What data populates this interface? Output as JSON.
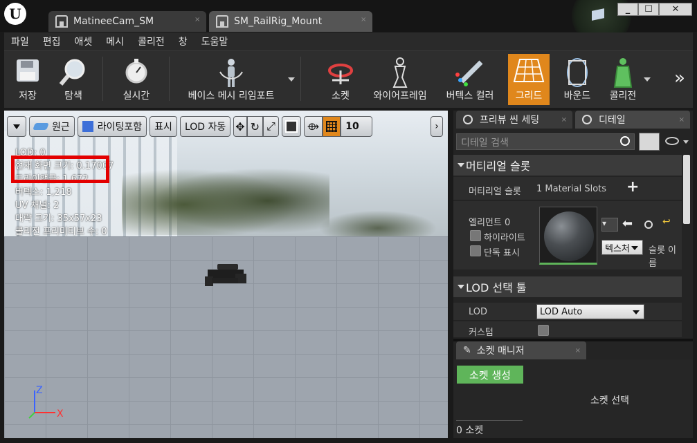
{
  "titlebar": {
    "tabs": [
      {
        "label": "MatineeCam_SM",
        "active": false
      },
      {
        "label": "SM_RailRig_Mount",
        "active": true
      }
    ],
    "window_buttons": [
      "_",
      "☐",
      "✕"
    ]
  },
  "menu": {
    "items": [
      "파일",
      "편집",
      "애셋",
      "메시",
      "콜리전",
      "창",
      "도움말"
    ]
  },
  "toolbar": {
    "buttons": [
      {
        "label": "저장",
        "icon": "save-icon"
      },
      {
        "label": "탐색",
        "icon": "browse-icon"
      },
      {
        "label": "실시간",
        "icon": "stopwatch-icon"
      },
      {
        "label": "베이스 메시 리임포트",
        "icon": "mannequin-icon"
      },
      {
        "label": "소켓",
        "icon": "socket-icon"
      },
      {
        "label": "와이어프레임",
        "icon": "wireframe-icon"
      },
      {
        "label": "버텍스 컬러",
        "icon": "vertex-color-icon"
      },
      {
        "label": "그리드",
        "icon": "grid-icon",
        "active": true
      },
      {
        "label": "바운드",
        "icon": "bounds-icon"
      },
      {
        "label": "콜리전",
        "icon": "collision-icon"
      }
    ],
    "overflow": "»",
    "accent": "#e0871c"
  },
  "viewport": {
    "toolbar": {
      "perspective": "원근",
      "lighting": "라이팅포함",
      "show": "표시",
      "lod": "LOD 자동",
      "grid_size": "10"
    },
    "stats": [
      "LOD:  0",
      "현재 화면 크기: 0.17007",
      "트라이앵글: 1,672",
      "버텍스: 1,218",
      "UV 채널:  2",
      "대략 크기: 35x57x23",
      "콜리전 프리미티브 수: 0"
    ],
    "axes": {
      "z": "Z",
      "x": "X"
    },
    "highlight_color": "#e30000"
  },
  "details": {
    "tabs": [
      "프리뷰 씬 세팅",
      "디테일"
    ],
    "search_placeholder": "디테일 검색",
    "material_section": {
      "title": "머티리얼 슬롯",
      "slots_label": "머티리얼 슬롯",
      "slots_value": "1 Material Slots",
      "element_label": "엘리먼트 0",
      "highlight_label": "하이라이트",
      "isolate_label": "단독 표시",
      "texture_button": "텍스처",
      "slot_name_label": "슬롯 이름"
    },
    "lod_section": {
      "title": "LOD 선택 툴",
      "lod_label": "LOD",
      "lod_value": "LOD Auto",
      "custom_label": "커스텀"
    }
  },
  "socket_manager": {
    "tab": "소켓 매니저",
    "create_button": "소켓 생성",
    "select_text": "소켓 선택",
    "count": "0 소켓"
  }
}
